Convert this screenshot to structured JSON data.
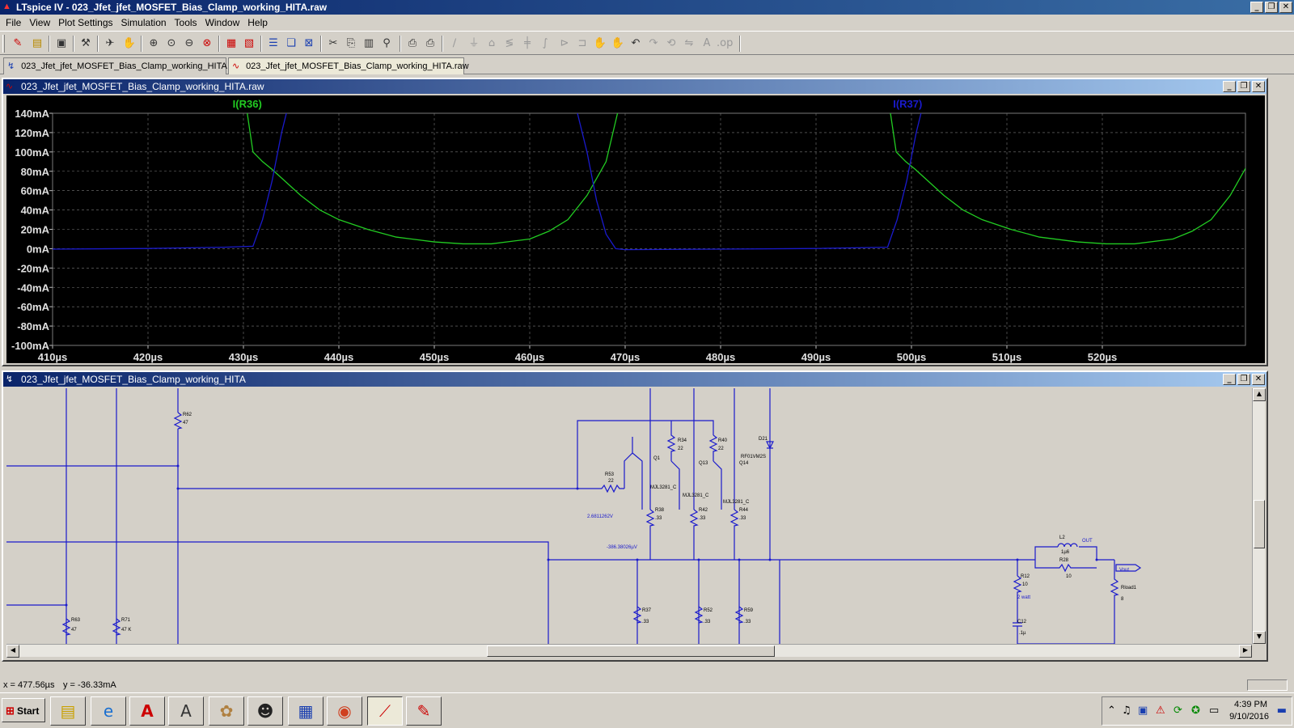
{
  "app": {
    "title": "LTspice IV - 023_Jfet_jfet_MOSFET_Bias_Clamp_working_HITA.raw"
  },
  "menu": [
    "File",
    "View",
    "Plot Settings",
    "Simulation",
    "Tools",
    "Window",
    "Help"
  ],
  "tabs": [
    {
      "label": "023_Jfet_jfet_MOSFET_Bias_Clamp_working_HITA",
      "icon": "schematic-icon"
    },
    {
      "label": "023_Jfet_jfet_MOSFET_Bias_Clamp_working_HITA.raw",
      "icon": "waveform-icon",
      "active": true
    }
  ],
  "plot_window": {
    "title": "023_Jfet_jfet_MOSFET_Bias_Clamp_working_HITA.raw"
  },
  "schematic_window": {
    "title": "023_Jfet_jfet_MOSFET_Bias_Clamp_working_HITA",
    "labels": [
      "R62",
      "47",
      "R63",
      "47",
      "R71",
      "47 K",
      "R53",
      "22",
      "Q1",
      "R34",
      "22",
      "Q13",
      "R40",
      "22",
      "Q14",
      "D21",
      "RF01VM2S",
      "MJL3281_C",
      "MJL3281_C",
      "MJL3281_C",
      "R38",
      ".33",
      "R42",
      ".33",
      "R44",
      ".33",
      "2.6811262V",
      "-386.38026µV",
      "R37",
      ".33",
      "R52",
      ".33",
      "R59",
      ".33",
      "L2",
      "1µ6",
      "OUT",
      "R28",
      "10",
      "Vout",
      "R12",
      "10",
      "2 watt",
      "C12",
      ".1µ",
      "Rload1",
      "8"
    ]
  },
  "status": {
    "x": "x = 477.56µs",
    "y": "y = -36.33mA"
  },
  "clock": {
    "time": "4:39 PM",
    "date": "9/10/2016"
  },
  "taskbar": {
    "start_label": "Start"
  },
  "colors": {
    "series1": "#22cc22",
    "series2": "#1a1acc",
    "plot_bg": "#000000",
    "grid": "#7a7a7a",
    "wire": "#1a1acc"
  },
  "chart_data": {
    "type": "line",
    "xlabel": "",
    "ylabel": "",
    "xlim": [
      410,
      535
    ],
    "ylim": [
      -100,
      140
    ],
    "x_ticks": [
      "410µs",
      "420µs",
      "430µs",
      "440µs",
      "450µs",
      "460µs",
      "470µs",
      "480µs",
      "490µs",
      "500µs",
      "510µs",
      "520µs"
    ],
    "x_tick_values": [
      410,
      420,
      430,
      440,
      450,
      460,
      470,
      480,
      490,
      500,
      510,
      520
    ],
    "y_ticks": [
      "140mA",
      "120mA",
      "100mA",
      "80mA",
      "60mA",
      "40mA",
      "20mA",
      "0mA",
      "-20mA",
      "-40mA",
      "-60mA",
      "-80mA",
      "-100mA"
    ],
    "y_tick_values": [
      140,
      120,
      100,
      80,
      60,
      40,
      20,
      0,
      -20,
      -40,
      -60,
      -80,
      -100
    ],
    "grid": true,
    "series": [
      {
        "name": "I(R36)",
        "color": "#22cc22",
        "x": [
          430.4,
          431.0,
          432.0,
          433.0,
          434.0,
          436.0,
          438.0,
          440.0,
          443.0,
          446.0,
          450.0,
          453.0,
          456.0,
          460.0,
          462.0,
          464.0,
          466.0,
          468.0,
          469.2
        ],
        "y": [
          140,
          100,
          90,
          82,
          73,
          55,
          40,
          30,
          20,
          12,
          7,
          5,
          5,
          10,
          18,
          30,
          55,
          90,
          140
        ]
      },
      {
        "name": "I(R37)",
        "color": "#1a1acc",
        "x": [
          410,
          420,
          428,
          431.0,
          432.0,
          433.0,
          434.0,
          434.5
        ],
        "y": [
          -0.5,
          0.2,
          1.5,
          2.5,
          30,
          70,
          120,
          140
        ]
      }
    ]
  }
}
